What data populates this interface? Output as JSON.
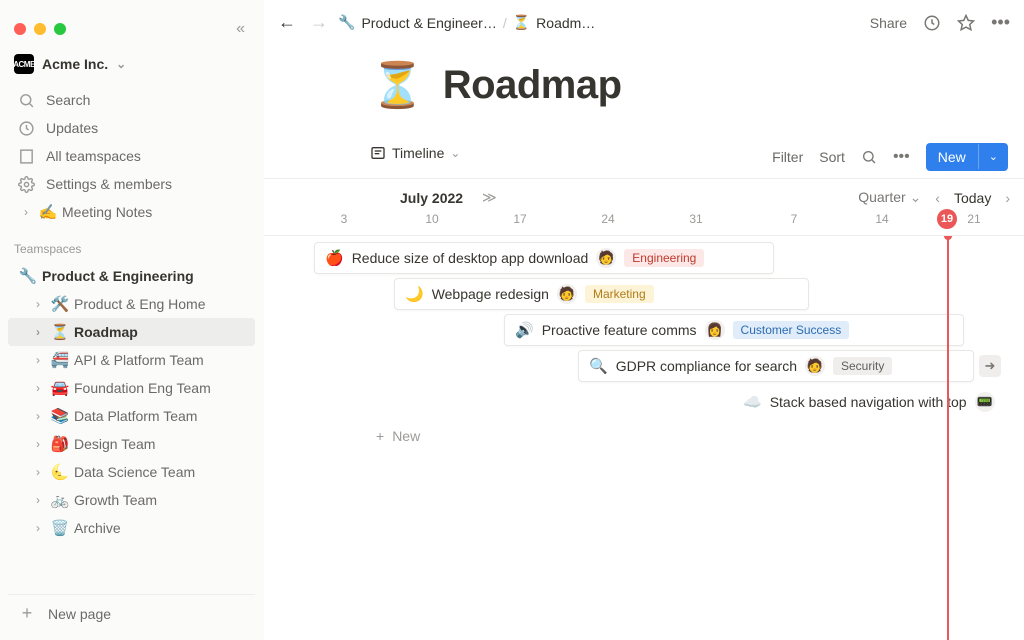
{
  "workspace": {
    "name": "Acme Inc.",
    "badge": "ACME"
  },
  "sidebar": {
    "search": "Search",
    "updates": "Updates",
    "all_teamspaces": "All teamspaces",
    "settings": "Settings & members",
    "section_label": "Teamspaces",
    "meeting_notes": "Meeting Notes",
    "teamspace": "Product & Engineering",
    "children": [
      {
        "emoji": "🛠️",
        "label": "Product & Eng Home"
      },
      {
        "emoji": "⏳",
        "label": "Roadmap"
      },
      {
        "emoji": "🚝",
        "label": "API & Platform Team"
      },
      {
        "emoji": "🚘",
        "label": "Foundation Eng Team"
      },
      {
        "emoji": "📚",
        "label": "Data Platform Team"
      },
      {
        "emoji": "🎒",
        "label": "Design Team"
      },
      {
        "emoji": "🌜",
        "label": "Data Science Team"
      },
      {
        "emoji": "🚲",
        "label": "Growth Team"
      },
      {
        "emoji": "🗑️",
        "label": "Archive"
      }
    ],
    "new_page": "New page"
  },
  "breadcrumb": {
    "crumb1_emoji": "🔧",
    "crumb1": "Product & Engineer…",
    "crumb2_emoji": "⏳",
    "crumb2": "Roadm…"
  },
  "topbar": {
    "share": "Share"
  },
  "page": {
    "emoji": "⏳",
    "title": "Roadmap"
  },
  "views": {
    "active": "Timeline",
    "filter": "Filter",
    "sort": "Sort",
    "new": "New"
  },
  "timeline": {
    "month": "July 2022",
    "scale": "Quarter",
    "today": "Today",
    "today_num": "19",
    "dates": [
      "3",
      "10",
      "17",
      "24",
      "31",
      "7",
      "14",
      "21"
    ],
    "new_row": "New",
    "cards": [
      {
        "emoji": "🍎",
        "title": "Reduce size of desktop app download",
        "avatar": "🧑",
        "tag": "Engineering",
        "tag_cls": "eng"
      },
      {
        "emoji": "🌙",
        "title": "Webpage redesign",
        "avatar": "🧑",
        "tag": "Marketing",
        "tag_cls": "mkt"
      },
      {
        "emoji": "🔊",
        "title": "Proactive feature comms",
        "avatar": "👩",
        "tag": "Customer Success",
        "tag_cls": "cs"
      },
      {
        "emoji": "🔍",
        "title": "GDPR compliance for search",
        "avatar": "🧑",
        "tag": "Security",
        "tag_cls": "sec"
      },
      {
        "emoji": "☁️",
        "title": "Stack based navigation with top",
        "avatar": "📟",
        "tag": "",
        "tag_cls": ""
      }
    ]
  }
}
